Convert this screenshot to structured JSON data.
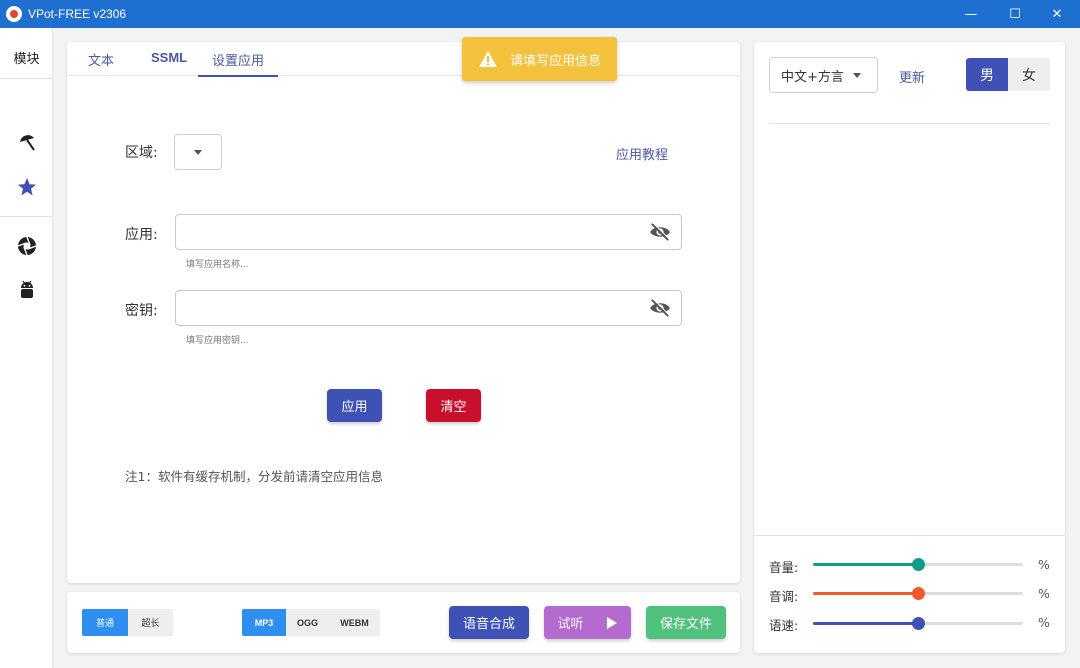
{
  "window": {
    "title": "VPot-FREE v2306"
  },
  "sidebar": {
    "header": "模块"
  },
  "tabs": [
    {
      "label": "文本"
    },
    {
      "label": "SSML"
    },
    {
      "label": "设置应用"
    }
  ],
  "toast": {
    "text": "请填写应用信息"
  },
  "form": {
    "region_label": "区域:",
    "tutorial_link": "应用教程",
    "app_label": "应用:",
    "app_placeholder": "填写应用名称...",
    "key_label": "密钥:",
    "key_placeholder": "填写应用密钥...",
    "apply_button": "应用",
    "clear_button": "清空",
    "note": "注1：软件有缓存机制，分发前请清空应用信息"
  },
  "bottom": {
    "length_options": [
      "普通",
      "超长"
    ],
    "length_selected": "普通",
    "format_options": [
      "MP3",
      "OGG",
      "WEBM"
    ],
    "format_selected": "MP3",
    "synthesize_button": "语音合成",
    "preview_button": "试听",
    "save_button": "保存文件"
  },
  "right": {
    "language": "中文+方言",
    "refresh": "更新",
    "gender_options": [
      "男",
      "女"
    ],
    "gender_selected": "男",
    "sliders": [
      {
        "label": "音量:",
        "value": 0.5,
        "color": "#0f9d8a",
        "unit": "%"
      },
      {
        "label": "音调:",
        "value": 0.5,
        "color": "#f15a2b",
        "unit": "%"
      },
      {
        "label": "语速:",
        "value": 0.5,
        "color": "#3f51b5",
        "unit": "%"
      }
    ]
  },
  "colors": {
    "titlebar": "#1f6fd0",
    "primary": "#3f51b5",
    "danger": "#c8102e",
    "toast": "#f4c13c",
    "preview": "#b36bd0",
    "save": "#4fc17c"
  }
}
